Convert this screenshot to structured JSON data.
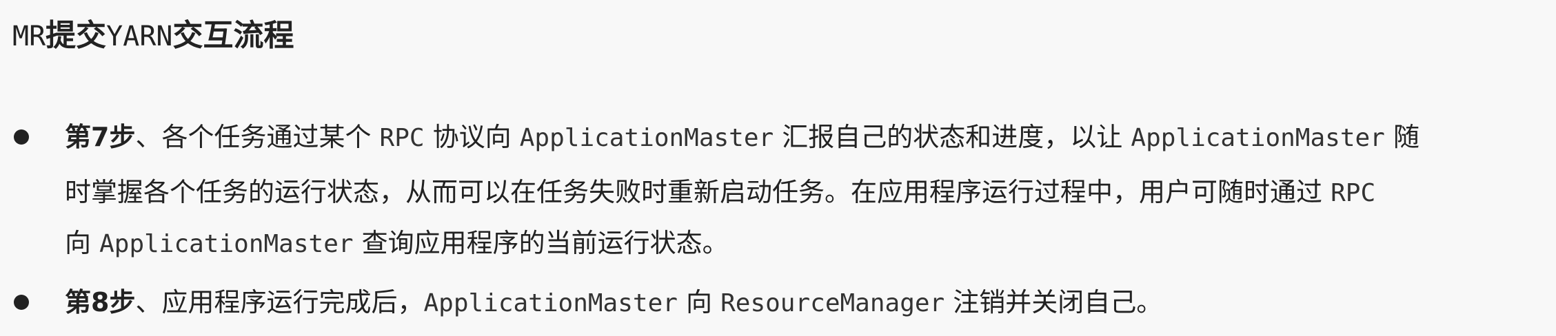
{
  "title": {
    "prefix": "MR",
    "part1": "提交",
    "mid": "YARN",
    "part2": "交互流程"
  },
  "items": [
    {
      "label": "第7步",
      "lines": [
        [
          {
            "t": "、各个任务通过某个 ",
            "mono": false
          },
          {
            "t": "RPC",
            "mono": true
          },
          {
            "t": " 协议向 ",
            "mono": false
          },
          {
            "t": "ApplicationMaster",
            "mono": true
          },
          {
            "t": " 汇报自己的状态和进度，以让 ",
            "mono": false
          },
          {
            "t": "ApplicationMaster",
            "mono": true
          },
          {
            "t": " 随",
            "mono": false
          }
        ],
        [
          {
            "t": "时掌握各个任务的运行状态，从而可以在任务失败时重新启动任务。在应用程序运行过程中，用户可随时通过 ",
            "mono": false
          },
          {
            "t": "RPC",
            "mono": true
          }
        ],
        [
          {
            "t": "向 ",
            "mono": false
          },
          {
            "t": "ApplicationMaster",
            "mono": true
          },
          {
            "t": " 查询应用程序的当前运行状态。",
            "mono": false
          }
        ]
      ]
    },
    {
      "label": "第8步",
      "lines": [
        [
          {
            "t": "、应用程序运行完成后，",
            "mono": false
          },
          {
            "t": "ApplicationMaster",
            "mono": true
          },
          {
            "t": " 向 ",
            "mono": false
          },
          {
            "t": "ResourceManager",
            "mono": true
          },
          {
            "t": " 注销并关闭自己。",
            "mono": false
          }
        ]
      ]
    }
  ]
}
